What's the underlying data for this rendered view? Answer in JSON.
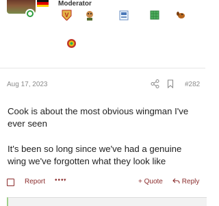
{
  "user": {
    "role": "Moderator"
  },
  "post": {
    "date": "Aug 17, 2023",
    "number": "#282",
    "lines": [
      "Cook is about the most obvious wingman I've",
      "ever seen",
      "It's been so long since we've had a genuine",
      "wing we've forgotten what they look like"
    ]
  },
  "actions": {
    "report": "Report",
    "more": "•••",
    "quote": "+ Quote",
    "reply": "Reply"
  },
  "colors": {
    "accent": "#8a2b2b",
    "online": "#2e9e3e",
    "muted": "#8a8a8a"
  },
  "icons": [
    "share-icon",
    "bookmark-icon",
    "reply-arrow-icon",
    "online-indicator-icon"
  ]
}
